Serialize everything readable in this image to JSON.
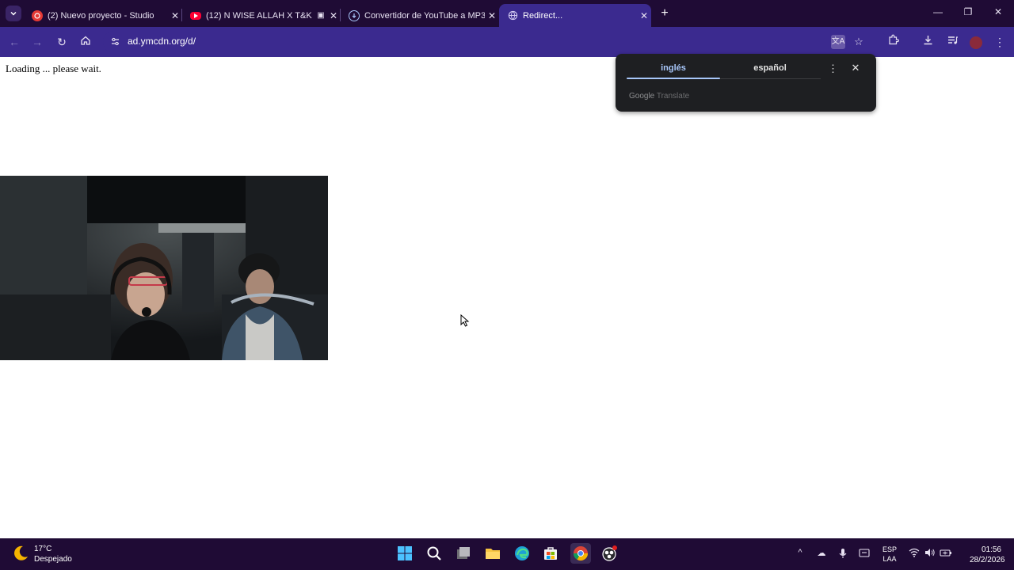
{
  "browser": {
    "tabs": [
      {
        "title": "(2) Nuevo proyecto - Studio",
        "favicon": "studio-icon",
        "active": false
      },
      {
        "title": "(12) N WISE ALLAH X T&K",
        "favicon": "youtube-icon",
        "active": false
      },
      {
        "title": "Convertidor de YouTube a MP3",
        "favicon": "download-icon",
        "active": false
      },
      {
        "title": "Redirect...",
        "favicon": "globe-icon",
        "active": true
      }
    ],
    "close_glyph": "✕",
    "new_tab_glyph": "+",
    "url": "ad.ymcdn.org/d/"
  },
  "page": {
    "loading_text": "Loading ... please wait."
  },
  "translate_popup": {
    "source_lang": "inglés",
    "target_lang": "español",
    "brand_google": "Google",
    "brand_translate": "Translate"
  },
  "taskbar": {
    "weather": {
      "temp": "17°C",
      "condition": "Despejado"
    },
    "lang_line1": "ESP",
    "lang_line2": "LAA",
    "time": "01:56",
    "date": "28/2/2026"
  },
  "colors": {
    "tabstrip_bg": "#1f0b35",
    "toolbar_bg": "#3b2a8f",
    "popup_bg": "#1e1f22",
    "popup_accent": "#a8c7fa"
  }
}
